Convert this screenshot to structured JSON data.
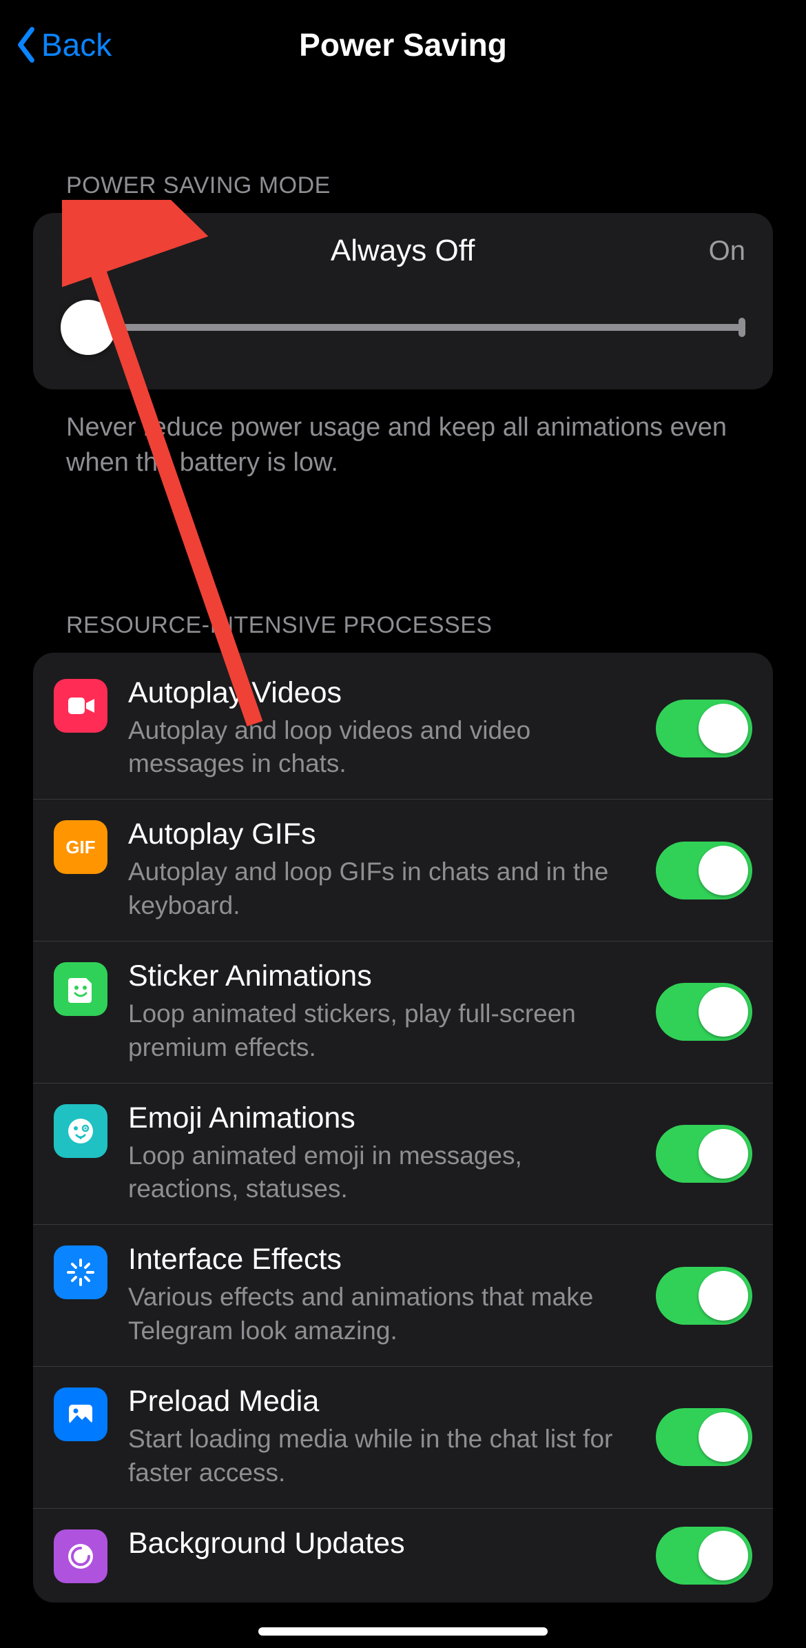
{
  "nav": {
    "back_label": "Back",
    "title": "Power Saving"
  },
  "section1": {
    "header": "POWER SAVING MODE",
    "slider": {
      "left": "Off",
      "center": "Always Off",
      "right": "On"
    },
    "note": "Never reduce power usage and keep all animations even when the battery is low."
  },
  "section2": {
    "header": "RESOURCE-INTENSIVE PROCESSES",
    "rows": [
      {
        "title": "Autoplay Videos",
        "sub": "Autoplay and loop videos and video messages in chats.",
        "icon": "video-icon",
        "icon_bg": "bg-red",
        "on": true
      },
      {
        "title": "Autoplay GIFs",
        "sub": "Autoplay and loop GIFs in chats and in the keyboard.",
        "icon": "gif-icon",
        "icon_bg": "bg-orange",
        "on": true
      },
      {
        "title": "Sticker Animations",
        "sub": "Loop animated stickers, play full-screen premium effects.",
        "icon": "sticker-icon",
        "icon_bg": "bg-green",
        "on": true
      },
      {
        "title": "Emoji Animations",
        "sub": "Loop animated emoji in messages, reactions, statuses.",
        "icon": "emoji-icon",
        "icon_bg": "bg-teal",
        "on": true
      },
      {
        "title": "Interface Effects",
        "sub": "Various effects and animations that make Telegram look amazing.",
        "icon": "sparkle-icon",
        "icon_bg": "bg-blue1",
        "on": true
      },
      {
        "title": "Preload Media",
        "sub": "Start loading media while in the chat list for faster access.",
        "icon": "photo-icon",
        "icon_bg": "bg-blue2",
        "on": true
      },
      {
        "title": "Background Updates",
        "sub": "",
        "icon": "refresh-icon",
        "icon_bg": "bg-purple",
        "on": true
      }
    ]
  }
}
